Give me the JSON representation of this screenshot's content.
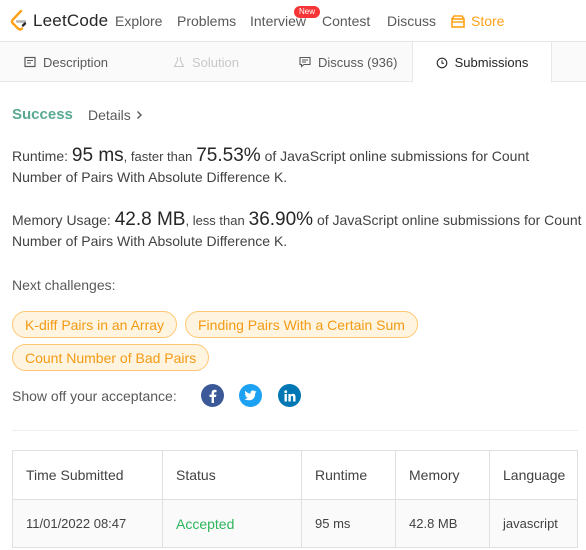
{
  "nav": {
    "logo_text": "LeetCode",
    "links": [
      "Explore",
      "Problems",
      "Interview",
      "Contest",
      "Discuss"
    ],
    "new_badge": "New",
    "store": "Store",
    "accent": "#ffa116"
  },
  "tabs": {
    "description": "Description",
    "solution": "Solution",
    "discuss": "Discuss (936)",
    "submissions": "Submissions"
  },
  "result": {
    "status": "Success",
    "details": "Details",
    "status_color": "#2db55d"
  },
  "runtime": {
    "label": "Runtime:",
    "value": "95 ms",
    "compare": ", faster than",
    "percent": "75.53%",
    "suffix": "of JavaScript online submissions for Count Number of Pairs With Absolute Difference K."
  },
  "memory": {
    "label": "Memory Usage:",
    "value": "42.8 MB",
    "compare": ", less than",
    "percent": "36.90%",
    "suffix": "of JavaScript online submissions for Count Number of Pairs With Absolute Difference K."
  },
  "next": {
    "label": "Next challenges:",
    "challenges": [
      "K-diff Pairs in an Array",
      "Finding Pairs With a Certain Sum",
      "Count Number of Bad Pairs"
    ]
  },
  "share": {
    "label": "Show off your acceptance:",
    "icons": [
      "facebook-icon",
      "twitter-icon",
      "linkedin-icon"
    ]
  },
  "table": {
    "headers": [
      "Time Submitted",
      "Status",
      "Runtime",
      "Memory",
      "Language"
    ],
    "rows": [
      [
        "11/01/2022 08:47",
        "Accepted",
        "95 ms",
        "42.8 MB",
        "javascript"
      ]
    ]
  }
}
